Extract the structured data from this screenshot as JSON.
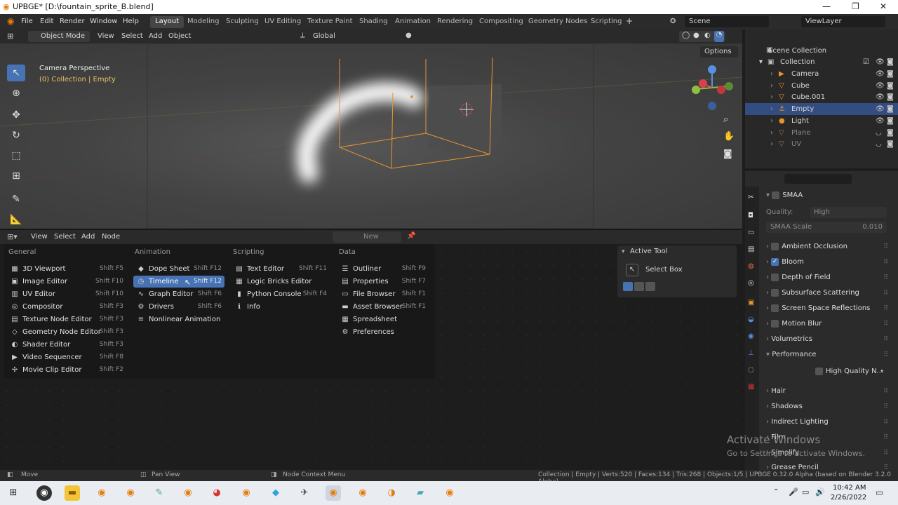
{
  "window": {
    "title": "UPBGE* [D:\\fountain_sprite_B.blend]",
    "minimize": "—",
    "maximize": "❐",
    "close": "✕"
  },
  "menubar": {
    "items": [
      "File",
      "Edit",
      "Render",
      "Window",
      "Help"
    ],
    "workspaces": [
      "Layout",
      "Modeling",
      "Sculpting",
      "UV Editing",
      "Texture Paint",
      "Shading",
      "Animation",
      "Rendering",
      "Compositing",
      "Geometry Nodes",
      "Scripting"
    ],
    "add": "+",
    "scene": "Scene",
    "view_layer": "ViewLayer"
  },
  "viewport_header": {
    "mode": "Object Mode",
    "menus": [
      "View",
      "Select",
      "Add",
      "Object"
    ],
    "transform": "Global",
    "options": "Options"
  },
  "viewport": {
    "camera": "Camera Perspective",
    "collection_info": "(0) Collection | Empty"
  },
  "editor_header": {
    "menus": [
      "View",
      "Select",
      "Add",
      "Node"
    ],
    "new_label": "New"
  },
  "editor_menu": {
    "columns": [
      {
        "title": "General",
        "items": [
          {
            "label": "3D Viewport",
            "shortcut": "Shift F5",
            "icon": "▦"
          },
          {
            "label": "Image Editor",
            "shortcut": "Shift F10",
            "icon": "▣"
          },
          {
            "label": "UV Editor",
            "shortcut": "Shift F10",
            "icon": "▥"
          },
          {
            "label": "Compositor",
            "shortcut": "Shift F3",
            "icon": "◎"
          },
          {
            "label": "Texture Node Editor",
            "shortcut": "Shift F3",
            "icon": "▤"
          },
          {
            "label": "Geometry Node Editor",
            "shortcut": "Shift F3",
            "icon": "◇"
          },
          {
            "label": "Shader Editor",
            "shortcut": "Shift F3",
            "icon": "◐"
          },
          {
            "label": "Video Sequencer",
            "shortcut": "Shift F8",
            "icon": "▶"
          },
          {
            "label": "Movie Clip Editor",
            "shortcut": "Shift F2",
            "icon": "✢"
          }
        ]
      },
      {
        "title": "Animation",
        "items": [
          {
            "label": "Dope Sheet",
            "shortcut": "Shift F12",
            "icon": "◆"
          },
          {
            "label": "Timeline",
            "shortcut": "Shift F12",
            "icon": "◷"
          },
          {
            "label": "Graph Editor",
            "shortcut": "Shift F6",
            "icon": "∿"
          },
          {
            "label": "Drivers",
            "shortcut": "Shift F6",
            "icon": "⚙"
          },
          {
            "label": "Nonlinear Animation",
            "shortcut": "",
            "icon": "≡"
          }
        ]
      },
      {
        "title": "Scripting",
        "items": [
          {
            "label": "Text Editor",
            "shortcut": "Shift F11",
            "icon": "▤"
          },
          {
            "label": "Logic Bricks Editor",
            "shortcut": "",
            "icon": "▦"
          },
          {
            "label": "Python Console",
            "shortcut": "Shift F4",
            "icon": "▮"
          },
          {
            "label": "Info",
            "shortcut": "",
            "icon": "ℹ"
          }
        ]
      },
      {
        "title": "Data",
        "items": [
          {
            "label": "Outliner",
            "shortcut": "Shift F9",
            "icon": "☰"
          },
          {
            "label": "Properties",
            "shortcut": "Shift F7",
            "icon": "▤"
          },
          {
            "label": "File Browser",
            "shortcut": "Shift F1",
            "icon": "▭"
          },
          {
            "label": "Asset Browser",
            "shortcut": "Shift F1",
            "icon": "▬"
          },
          {
            "label": "Spreadsheet",
            "shortcut": "",
            "icon": "▦"
          },
          {
            "label": "Preferences",
            "shortcut": "",
            "icon": "⚙"
          }
        ]
      }
    ]
  },
  "active_tool": {
    "title": "Active Tool",
    "tool": "Select Box"
  },
  "outliner": {
    "root": "Scene Collection",
    "collection": "Collection",
    "objects": [
      {
        "name": "Camera",
        "icon": "▶"
      },
      {
        "name": "Cube",
        "icon": "▽"
      },
      {
        "name": "Cube.001",
        "icon": "▽"
      },
      {
        "name": "Empty",
        "icon": "⚓"
      },
      {
        "name": "Light",
        "icon": "●"
      },
      {
        "name": "Plane",
        "icon": "▽"
      },
      {
        "name": "UV",
        "icon": "▽"
      }
    ]
  },
  "properties": {
    "smaa": "SMAA",
    "quality_label": "Quality:",
    "quality_value": "High",
    "smaa_scale_label": "SMAA Scale",
    "smaa_scale_value": "0.010",
    "sections": [
      "Ambient Occlusion",
      "Bloom",
      "Depth of Field",
      "Subsurface Scattering",
      "Screen Space Reflections",
      "Motion Blur",
      "Volumetrics",
      "Performance"
    ],
    "high_quality": "High Quality N...",
    "sections2": [
      "Hair",
      "Shadows",
      "Indirect Lighting",
      "Film",
      "Simplify",
      "Grease Pencil"
    ]
  },
  "watermark": {
    "line1": "Activate Windows",
    "line2": "Go to Settings to activate Windows."
  },
  "statusbar": {
    "move": "Move",
    "pan": "Pan View",
    "context": "Node Context Menu",
    "info": "Collection | Empty | Verts:520 | Faces:134 | Tris:268 | Objects:1/5 | UPBGE 0.32.0 Alpha (based on Blender 3.2.0 Alpha)"
  },
  "taskbar": {
    "time": "10:42 AM",
    "date": "2/26/2022"
  },
  "colors": {
    "accent": "#4772b3",
    "selection_orange": "#e8952c"
  }
}
